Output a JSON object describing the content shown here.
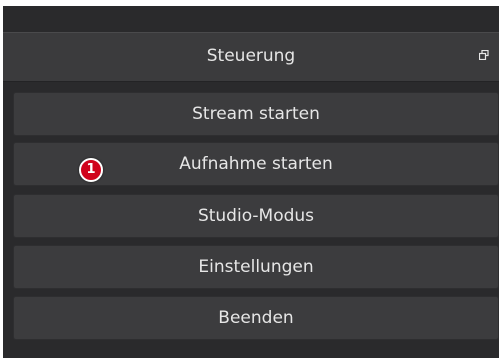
{
  "dock": {
    "title": "Steuerung",
    "undock_icon": "float-window-icon"
  },
  "buttons": [
    {
      "label": "Stream starten"
    },
    {
      "label": "Aufnahme starten"
    },
    {
      "label": "Studio-Modus"
    },
    {
      "label": "Einstellungen"
    },
    {
      "label": "Beenden"
    }
  ],
  "annotation": {
    "number": "1",
    "color": "#d0021b"
  },
  "colors": {
    "panel_bg": "#2a2a2c",
    "header_bg": "#3b3b3d",
    "button_bg": "#3c3c3e",
    "text": "#e6e6e6"
  }
}
